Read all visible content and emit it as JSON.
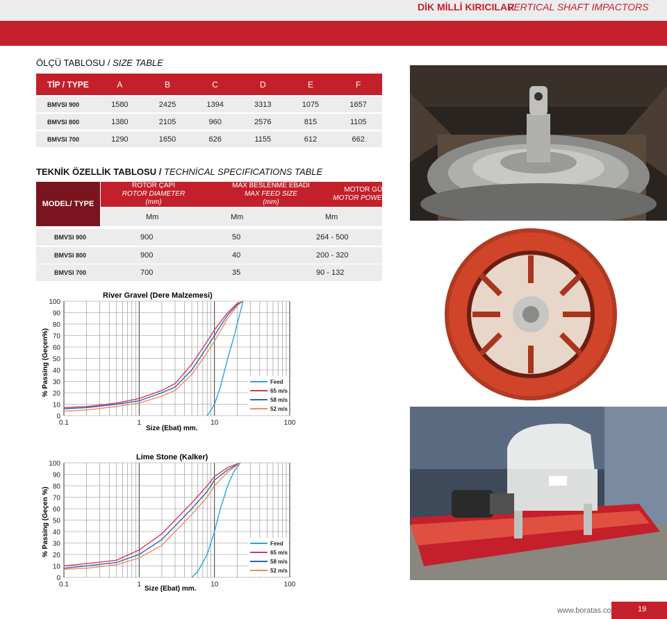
{
  "header": {
    "title_tr": "DİK MİLLİ KIRICILAR",
    "title_en": "VERTICAL SHAFT IMPACTORS"
  },
  "size_table": {
    "title_tr": "ÖLÇÜ TABLOSU /",
    "title_en": "SIZE TABLE",
    "header": [
      "TİP / TYPE",
      "A",
      "B",
      "C",
      "D",
      "E",
      "F"
    ],
    "rows": [
      [
        "BMVSI 900",
        "1580",
        "2425",
        "1394",
        "3313",
        "1075",
        "1657"
      ],
      [
        "BMVSI 800",
        "1380",
        "2105",
        "960",
        "2576",
        "815",
        "1105"
      ],
      [
        "BMVSI 700",
        "1290",
        "1650",
        "626",
        "1155",
        "612",
        "662"
      ]
    ]
  },
  "spec_table": {
    "title_tr": "TEKNİK ÖZELLİK TABLOSU /",
    "title_en": "TECHNİCAL SPECIFICATIONS TABLE",
    "model_label": "MODEL/ TYPE",
    "col1_tr": "ROTOR ÇAPI",
    "col1_en": "ROTOR DIAMETER (mm)",
    "col2_tr": "MAX BESLENME EBADI",
    "col2_en1": "MAX FEED SIZE",
    "col2_en2": "(mm)",
    "col3_tr": "MOTOR GÜCÜ",
    "col3_en": "MOTOR POWER (kW)",
    "units": [
      "Mm",
      "Mm",
      "Mm"
    ],
    "rows": [
      [
        "BMVSI 900",
        "900",
        "50",
        "264 - 500"
      ],
      [
        "BMVSI 800",
        "900",
        "40",
        "200 - 320"
      ],
      [
        "BMVSI 700",
        "700",
        "35",
        "90 - 132"
      ]
    ]
  },
  "charts_text": [
    {
      "title": "River Gravel (Dere Malzemesi)",
      "ylabel": "% Passing (Geçen%)",
      "xlabel": "Size (Ebat) mm.",
      "x_ticks": [
        "0.1",
        "1",
        "10",
        "100"
      ],
      "y_ticks": [
        "0",
        "10",
        "20",
        "30",
        "40",
        "50",
        "60",
        "70",
        "80",
        "90",
        "100"
      ]
    },
    {
      "title": "Lime Stone (Kalker)",
      "ylabel": "% Passing (Geçen %)",
      "xlabel": "Size (Ebat) mm.",
      "x_ticks": [
        "0.1",
        "1",
        "10",
        "100"
      ],
      "y_ticks": [
        "0",
        "10",
        "20",
        "30",
        "40",
        "50",
        "60",
        "70",
        "80",
        "90",
        "100"
      ]
    }
  ],
  "chart_data": [
    {
      "type": "line",
      "title": "River Gravel (Dere Malzemesi)",
      "xlabel": "Size (Ebat) mm.",
      "ylabel": "% Passing (Geçen%)",
      "xscale": "log",
      "xlim": [
        0.1,
        100
      ],
      "ylim": [
        0,
        100
      ],
      "grid": true,
      "legend": "bottom-right",
      "series": [
        {
          "name": "Feed",
          "color": "#22a6e0",
          "points": [
            [
              8,
              0
            ],
            [
              9,
              5
            ],
            [
              10,
              10
            ],
            [
              12,
              25
            ],
            [
              15,
              50
            ],
            [
              18,
              68
            ],
            [
              20,
              80
            ],
            [
              24,
              100
            ]
          ]
        },
        {
          "name": "65 m/s",
          "color": "#d9365c",
          "points": [
            [
              0.1,
              7
            ],
            [
              0.2,
              8
            ],
            [
              0.5,
              11
            ],
            [
              1,
              15
            ],
            [
              2,
              22
            ],
            [
              3,
              28
            ],
            [
              5,
              45
            ],
            [
              8,
              65
            ],
            [
              10,
              75
            ],
            [
              15,
              90
            ],
            [
              20,
              98
            ],
            [
              24,
              100
            ]
          ]
        },
        {
          "name": "58 m/s",
          "color": "#2f64b0",
          "points": [
            [
              0.1,
              6
            ],
            [
              0.2,
              7
            ],
            [
              0.5,
              10
            ],
            [
              1,
              13
            ],
            [
              2,
              20
            ],
            [
              3,
              25
            ],
            [
              5,
              40
            ],
            [
              8,
              60
            ],
            [
              10,
              70
            ],
            [
              15,
              88
            ],
            [
              20,
              97
            ],
            [
              24,
              100
            ]
          ]
        },
        {
          "name": "52 m/s",
          "color": "#f08a5a",
          "points": [
            [
              0.1,
              4
            ],
            [
              0.2,
              5
            ],
            [
              0.5,
              8
            ],
            [
              1,
              11
            ],
            [
              2,
              17
            ],
            [
              3,
              22
            ],
            [
              5,
              36
            ],
            [
              8,
              55
            ],
            [
              10,
              65
            ],
            [
              15,
              85
            ],
            [
              20,
              96
            ],
            [
              24,
              100
            ]
          ]
        }
      ]
    },
    {
      "type": "line",
      "title": "Lime Stone (Kalker)",
      "xlabel": "Size (Ebat) mm.",
      "ylabel": "% Passing (Geçen %)",
      "xscale": "log",
      "xlim": [
        0.1,
        100
      ],
      "ylim": [
        0,
        100
      ],
      "grid": true,
      "legend": "bottom-right",
      "series": [
        {
          "name": "Feed",
          "color": "#22a6e0",
          "points": [
            [
              5,
              0
            ],
            [
              6,
              5
            ],
            [
              8,
              20
            ],
            [
              10,
              40
            ],
            [
              12,
              60
            ],
            [
              15,
              80
            ],
            [
              18,
              92
            ],
            [
              22,
              100
            ]
          ]
        },
        {
          "name": "65 m/s",
          "color": "#d9365c",
          "points": [
            [
              0.1,
              10
            ],
            [
              0.2,
              12
            ],
            [
              0.5,
              15
            ],
            [
              1,
              24
            ],
            [
              2,
              38
            ],
            [
              3,
              50
            ],
            [
              5,
              65
            ],
            [
              8,
              80
            ],
            [
              10,
              88
            ],
            [
              15,
              96
            ],
            [
              22,
              100
            ]
          ]
        },
        {
          "name": "58 m/s",
          "color": "#2f64b0",
          "points": [
            [
              0.1,
              8
            ],
            [
              0.2,
              10
            ],
            [
              0.5,
              13
            ],
            [
              1,
              20
            ],
            [
              2,
              33
            ],
            [
              3,
              45
            ],
            [
              5,
              60
            ],
            [
              8,
              75
            ],
            [
              10,
              85
            ],
            [
              15,
              94
            ],
            [
              22,
              100
            ]
          ]
        },
        {
          "name": "52 m/s",
          "color": "#f08a5a",
          "points": [
            [
              0.1,
              7
            ],
            [
              0.2,
              8
            ],
            [
              0.5,
              11
            ],
            [
              1,
              17
            ],
            [
              2,
              28
            ],
            [
              3,
              40
            ],
            [
              5,
              55
            ],
            [
              8,
              70
            ],
            [
              10,
              80
            ],
            [
              15,
              92
            ],
            [
              22,
              100
            ]
          ]
        }
      ]
    }
  ],
  "footer": {
    "url": "www.boratas.com.tr",
    "page": "19"
  },
  "colors": {
    "brand_red": "#c4202b",
    "dark_red": "#7a1520",
    "light_gray": "#ececec"
  },
  "photos": [
    "rotor-photo",
    "rotor-housing-photo",
    "crusher-machine-photo"
  ]
}
